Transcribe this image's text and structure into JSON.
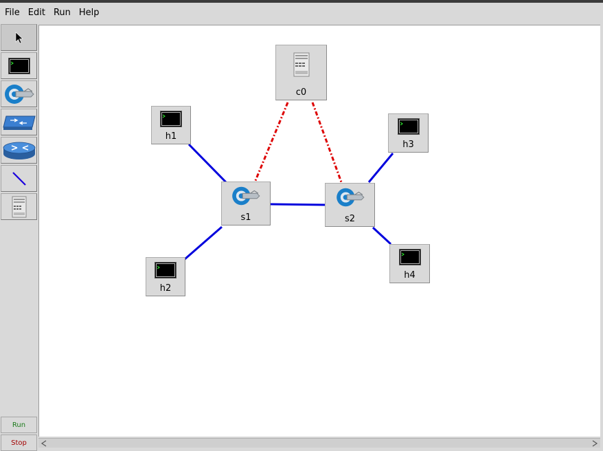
{
  "menu": {
    "file": "File",
    "edit": "Edit",
    "run": "Run",
    "help": "Help"
  },
  "toolbar": {
    "tools": [
      "select-tool",
      "host-tool",
      "switch-tool",
      "legacy-switch-tool",
      "router-tool",
      "link-tool",
      "controller-tool"
    ],
    "run_label": "Run",
    "stop_label": "Stop"
  },
  "colors": {
    "link_color": "#0000dd",
    "controller_link_color": "#dd0000",
    "run_color": "#1b7a1b",
    "stop_color": "#a30000"
  },
  "nodes": {
    "c0": "c0",
    "h1": "h1",
    "h2": "h2",
    "h3": "h3",
    "h4": "h4",
    "s1": "s1",
    "s2": "s2"
  }
}
